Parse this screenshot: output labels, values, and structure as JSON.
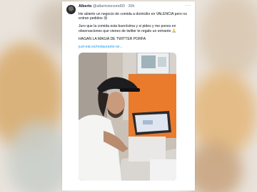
{
  "tweet": {
    "display_name": "Alberto",
    "handle": "@albertotonsmd93",
    "separator": "·",
    "time": "20h",
    "more_icon": "more-dots-icon",
    "paragraphs": [
      "He abierto un negocio de comida a domicilio en VALENCIA pero no entran pedidos 😢",
      "Juro que la comida esta buenísima y si pides y me pones en observaciones que vienes de twitter te regalo un entrante 🙏",
      "HAGAN LA MAGIA DE TWITTER PORFA"
    ],
    "link": "just-eat.es/restaurants-se...",
    "media_icon": "photo-image"
  }
}
